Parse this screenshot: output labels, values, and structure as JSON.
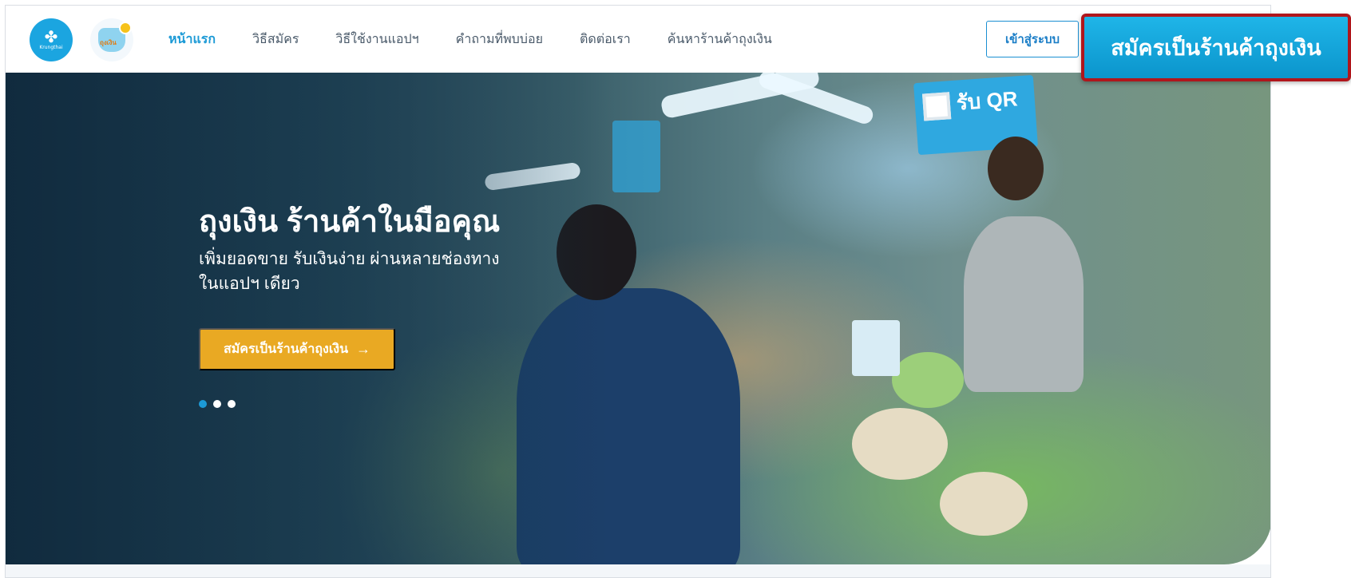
{
  "brand": {
    "bank_logo_text": "Krungthai",
    "app_logo_text": "ถุงเงิน"
  },
  "nav": {
    "items": [
      {
        "label": "หน้าแรก",
        "active": true
      },
      {
        "label": "วิธีสมัคร",
        "active": false
      },
      {
        "label": "วิธีใช้งานแอปฯ",
        "active": false
      },
      {
        "label": "คำถามที่พบบ่อย",
        "active": false
      },
      {
        "label": "ติดต่อเรา",
        "active": false
      },
      {
        "label": "ค้นหาร้านค้าถุงเงิน",
        "active": false
      }
    ],
    "login_label": "เข้าสู่ระบบ",
    "signup_label": "สมัครเป็นร้านค้าถุงเงิน"
  },
  "hero": {
    "title": "ถุงเงิน ร้านค้าในมือคุณ",
    "subtitle_line1": "เพิ่มยอดขาย รับเงินง่าย ผ่านหลายช่องทาง",
    "subtitle_line2": "ในแอปฯ เดียว",
    "cta_label": "สมัครเป็นร้านค้าถุงเงิน",
    "cta_icon": "arrow-right-icon",
    "sign_text": "รับ QR",
    "slides_total": 3,
    "slide_active": 1
  },
  "colors": {
    "accent": "#1c9ad6",
    "cta": "#e9a923",
    "signup_bg": "#0ea3d9",
    "signup_border": "#b0161c"
  }
}
